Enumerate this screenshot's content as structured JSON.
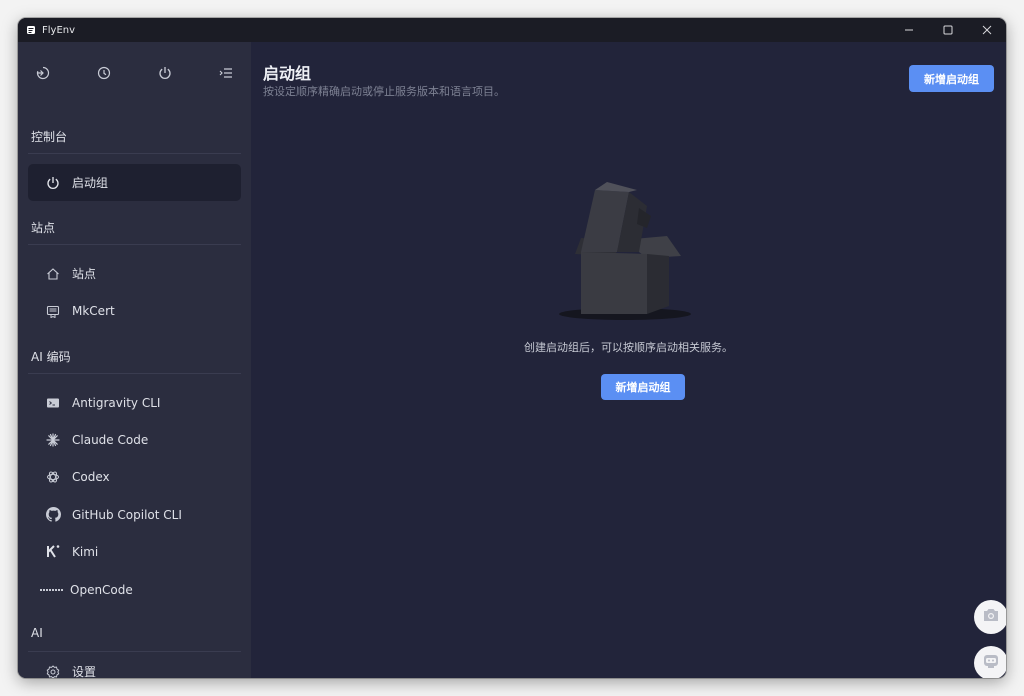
{
  "window": {
    "title": "FlyEnv"
  },
  "sidebar": {
    "top_icons": [
      "back-icon",
      "clock-icon",
      "power-icon",
      "menu-collapse-icon"
    ],
    "sections": {
      "console": {
        "title": "控制台",
        "items": [
          {
            "label": "启动组",
            "icon": "power-icon"
          }
        ]
      },
      "sites": {
        "title": "站点",
        "items": [
          {
            "label": "站点",
            "icon": "home-icon"
          },
          {
            "label": "MkCert",
            "icon": "certificate-icon"
          }
        ]
      },
      "ai_coding": {
        "title": "AI 编码",
        "items": [
          {
            "label": "Antigravity CLI",
            "icon": "terminal-icon"
          },
          {
            "label": "Claude Code",
            "icon": "claude-sparkle-icon"
          },
          {
            "label": "Codex",
            "icon": "openai-knot-icon"
          },
          {
            "label": "GitHub Copilot CLI",
            "icon": "github-icon"
          },
          {
            "label": "Kimi",
            "icon": "kimi-k-icon"
          },
          {
            "label": "OpenCode",
            "icon": "opencode-dots-icon"
          }
        ]
      },
      "ai": {
        "title": "AI",
        "items": [
          {
            "label": "设置",
            "icon": "gear-icon"
          }
        ]
      }
    }
  },
  "main": {
    "title": "启动组",
    "subtitle": "按设定顺序精确启动或停止服务版本和语言项目。",
    "add_button": "新增启动组",
    "empty_text": "创建启动组后，可以按顺序启动相关服务。",
    "empty_add_button": "新增启动组"
  },
  "fabs": [
    "camera-icon",
    "robot-icon"
  ],
  "colors": {
    "accent": "#5b8ff3",
    "sidebar_bg": "#2b2d3f",
    "main_bg": "#22243a",
    "titlebar_bg": "#1b1c25"
  }
}
